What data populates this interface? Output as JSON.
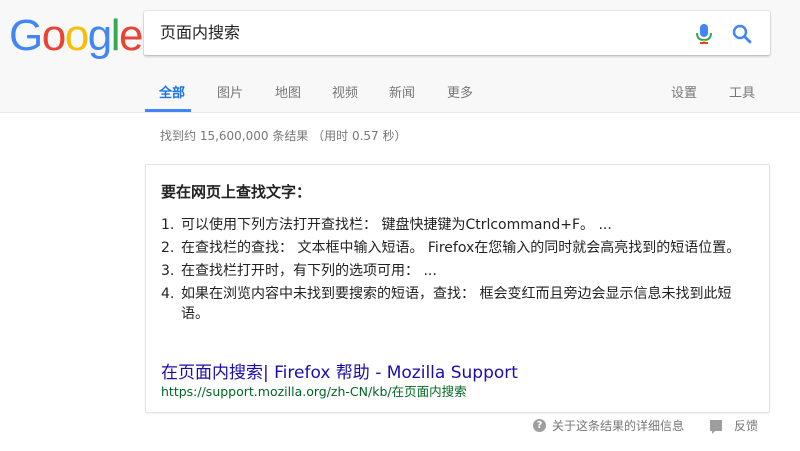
{
  "logo": {
    "letters": [
      "G",
      "o",
      "o",
      "g",
      "l",
      "e"
    ],
    "colors": [
      "#4285f4",
      "#ea4335",
      "#fbbc05",
      "#4285f4",
      "#34a853",
      "#ea4335"
    ]
  },
  "search": {
    "query": "页面内搜索"
  },
  "tabs": [
    {
      "label": "全部"
    },
    {
      "label": "图片"
    },
    {
      "label": "地图"
    },
    {
      "label": "视频"
    },
    {
      "label": "新闻"
    },
    {
      "label": "更多"
    }
  ],
  "tools": {
    "settings": "设置",
    "tools": "工具"
  },
  "result_stats": "找到约 15,600,000 条结果 （用时 0.57 秒）",
  "snippet": {
    "title": "要在网页上查找文字：",
    "steps": [
      {
        "num": "1.",
        "text": "可以使用下列方法打开查找栏： 键盘快捷键为Ctrlcommand+F。 ..."
      },
      {
        "num": "2.",
        "text": "在查找栏的查找： 文本框中输入短语。 Firefox在您输入的同时就会高亮找到的短语位置。"
      },
      {
        "num": "3.",
        "text": "在查找栏打开时，有下列的选项可用： ..."
      },
      {
        "num": "4.",
        "text": "如果在浏览内容中未找到要搜索的短语，查找： 框会变红而且旁边会显示信息未找到此短语。"
      }
    ],
    "link": "在页面内搜索| Firefox 帮助 - Mozilla Support",
    "url": "https://support.mozilla.org/zh-CN/kb/在页面内搜索"
  },
  "footer": {
    "about": "关于这条结果的详细信息",
    "feedback": "反馈"
  },
  "colors": {
    "accent": "#4285f4",
    "link": "#1a0dab",
    "url": "#006621"
  }
}
